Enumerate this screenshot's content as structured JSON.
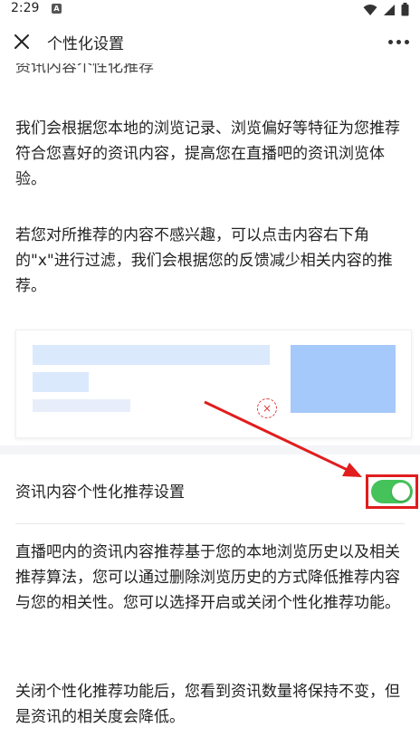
{
  "status_bar": {
    "time": "2:29",
    "notification_letter": "A",
    "icons": [
      "wifi-icon",
      "signal-icon",
      "battery-icon"
    ]
  },
  "app_bar": {
    "title": "个性化设置",
    "close_icon": "close-icon",
    "more_icon": "more-icon"
  },
  "content": {
    "partial_heading": "资讯内容个性化推荐",
    "paragraph_1": "我们会根据您本地的浏览记录、浏览偏好等特征为您推荐符合您喜好的资讯内容，提高您在直播吧的资讯浏览体验。",
    "paragraph_2": "若您对所推荐的内容不感兴趣，可以点击内容右下角的\"x\"进行过滤，我们会根据您的反馈减少相关内容的推荐。",
    "illustration_mark": "×",
    "setting_label": "资讯内容个性化推荐设置",
    "setting_enabled": true,
    "paragraph_3": "直播吧内的资讯内容推荐基于您的本地浏览历史以及相关推荐算法，您可以通过删除浏览历史的方式降低推荐内容与您的相关性。您可以选择开启或关闭个性化推荐功能。",
    "paragraph_4": "关闭个性化推荐功能后，您看到资讯数量将保持不变，但是资讯的相关度会降低。"
  },
  "colors": {
    "toggle_on": "#45c25a",
    "highlight_border": "#e11d1d",
    "annotation_arrow": "#e11d1d",
    "placeholder_block": "#dbe9fc",
    "placeholder_image": "#a6c9fb"
  }
}
